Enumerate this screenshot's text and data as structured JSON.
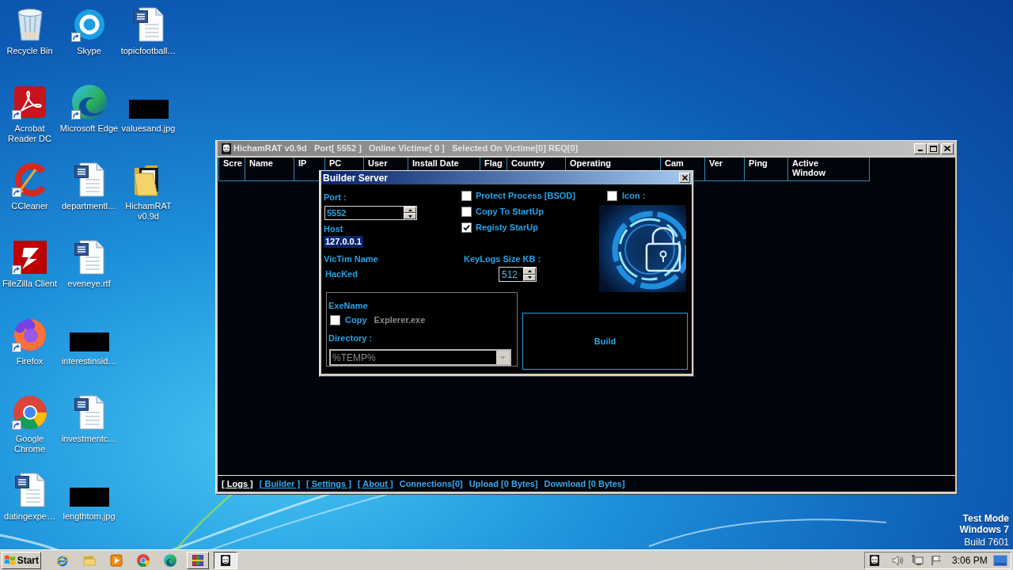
{
  "desktop": {
    "icons": [
      {
        "label": "Recycle Bin",
        "kind": "recycle-bin",
        "shortcut": false
      },
      {
        "label": "Acrobat Reader DC",
        "kind": "acrobat",
        "shortcut": true
      },
      {
        "label": "CCleaner",
        "kind": "ccleaner",
        "shortcut": true
      },
      {
        "label": "FileZilla Client",
        "kind": "filezilla",
        "shortcut": true
      },
      {
        "label": "Firefox",
        "kind": "firefox",
        "shortcut": true
      },
      {
        "label": "Google Chrome",
        "kind": "chrome",
        "shortcut": true
      },
      {
        "label": "datingexpe…",
        "kind": "word",
        "shortcut": false
      },
      {
        "label": "Skype",
        "kind": "skype",
        "shortcut": true
      },
      {
        "label": "Microsoft Edge",
        "kind": "edge",
        "shortcut": true
      },
      {
        "label": "departmentl…",
        "kind": "word",
        "shortcut": false
      },
      {
        "label": "eveneye.rtf",
        "kind": "word",
        "shortcut": false
      },
      {
        "label": "interestinsid…",
        "kind": "image",
        "shortcut": false
      },
      {
        "label": "investmentc…",
        "kind": "word",
        "shortcut": false
      },
      {
        "label": "lengthtom.jpg",
        "kind": "image",
        "shortcut": false
      },
      {
        "label": "topicfootball…",
        "kind": "word",
        "shortcut": false
      },
      {
        "label": "valuesand.jpg",
        "kind": "image",
        "shortcut": false
      },
      {
        "label": "HichamRAT v0.9d",
        "kind": "folder",
        "shortcut": false
      }
    ]
  },
  "os_notice": [
    "Test Mode",
    "Windows 7",
    "Build 7601"
  ],
  "main_window": {
    "title": "HichamRAT v0.9d   Port[ 5552 ]   Online Victime[ 0 ]   Selected On Victime[0] REQ[0]",
    "columns": [
      {
        "label": "Scre"
      },
      {
        "label": "Name"
      },
      {
        "label": "IP"
      },
      {
        "label": "PC"
      },
      {
        "label": "User"
      },
      {
        "label": "Install Date"
      },
      {
        "label": "Flag"
      },
      {
        "label": "Country"
      },
      {
        "label": "Operating"
      },
      {
        "label": "Cam"
      },
      {
        "label": "Ver"
      },
      {
        "label": "Ping"
      },
      {
        "label": "Active Window"
      }
    ],
    "status_items": [
      {
        "label": "[ Logs ]",
        "kind": "link",
        "selected": true
      },
      {
        "label": "[ Builder ]",
        "kind": "link",
        "selected": false
      },
      {
        "label": "[ Settings ]",
        "kind": "link",
        "selected": false
      },
      {
        "label": "[ About ]",
        "kind": "link",
        "selected": false
      },
      {
        "label": "Connections[0]",
        "kind": "counter",
        "selected": false
      },
      {
        "label": "Upload [0 Bytes]",
        "kind": "counter",
        "selected": false
      },
      {
        "label": "Download [0 Bytes]",
        "kind": "counter",
        "selected": false
      }
    ]
  },
  "builder_dialog": {
    "title": "Builder Server",
    "port": {
      "label": "Port :",
      "value": "5552"
    },
    "host": {
      "label": "Host",
      "value": "127.0.0.1",
      "selected": true
    },
    "victim_name": {
      "label": "VicTim Name",
      "value": "HacKed"
    },
    "options": [
      {
        "label": "Protect Process [BSOD]",
        "checked": false
      },
      {
        "label": "Copy To StartUp",
        "checked": false
      },
      {
        "label": "Registy StarUp",
        "checked": true
      }
    ],
    "icon_option": {
      "label": "Icon :",
      "checked": false
    },
    "keylogs": {
      "label": "KeyLogs Size KB :",
      "value": "512"
    },
    "exe_group": {
      "label": "ExeName",
      "copy": {
        "label": "Copy",
        "checked": false
      },
      "exe_name": {
        "value": "Explerer.exe",
        "disabled": true
      },
      "directory": {
        "label": "Directory :",
        "value": "%TEMP%",
        "disabled": true
      }
    },
    "build_button": {
      "label": "Build"
    }
  },
  "taskbar": {
    "start": "Start",
    "tasks": [
      {
        "kind": "archive",
        "selected": false
      },
      {
        "kind": "mask",
        "selected": true
      }
    ],
    "clock": "3:06 PM"
  }
}
